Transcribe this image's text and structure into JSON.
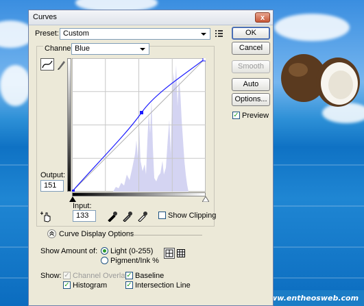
{
  "window": {
    "title": "Curves",
    "close_glyph": "x"
  },
  "preset": {
    "label": "Preset:",
    "value": "Custom",
    "menu_icon": "preset-options-icon"
  },
  "channel": {
    "label": "Channel:",
    "value": "Blue"
  },
  "graph": {
    "output_label": "Output:",
    "output_value": "151",
    "input_label": "Input:",
    "input_value": "133",
    "curve_color": "#1a1aff",
    "histogram_color": "#d3d3f2"
  },
  "buttons": {
    "ok": "OK",
    "cancel": "Cancel",
    "smooth": "Smooth",
    "auto": "Auto",
    "options": "Options..."
  },
  "preview": {
    "label": "Preview",
    "checked": true
  },
  "show_clipping": {
    "label": "Show Clipping",
    "checked": false
  },
  "display_options": {
    "header": "Curve Display Options",
    "show_amount_label": "Show Amount of:",
    "light_label": "Light  (0-255)",
    "pigment_label": "Pigment/Ink %",
    "show_label": "Show:",
    "channel_overlays": "Channel Overlays",
    "baseline": "Baseline",
    "histogram": "Histogram",
    "intersection_line": "Intersection Line"
  },
  "watermark": "www.entheosweb.com"
}
